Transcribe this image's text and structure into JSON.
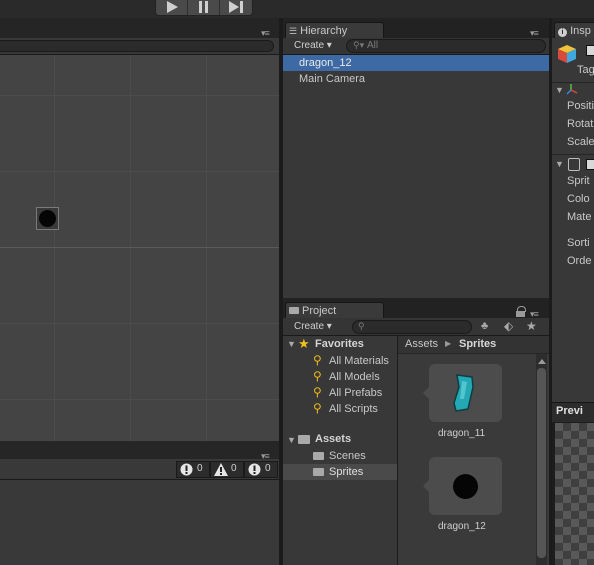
{
  "play_controls": {
    "play_icon": "play-icon",
    "pause_icon": "pause-icon",
    "step_icon": "step-icon"
  },
  "console_counts": {
    "errors": "0",
    "warnings": "0",
    "messages": "0"
  },
  "hierarchy": {
    "tab_label": "Hierarchy",
    "create_label": "Create",
    "search_placeholder": "All",
    "items": [
      {
        "label": "dragon_12",
        "selected": true
      },
      {
        "label": "Main Camera",
        "selected": false
      }
    ]
  },
  "project": {
    "tab_label": "Project",
    "create_label": "Create",
    "favorites_label": "Favorites",
    "favorites": [
      "All Materials",
      "All Models",
      "All Prefabs",
      "All Scripts"
    ],
    "assets_label": "Assets",
    "assets_children": [
      {
        "label": "Scenes",
        "selected": false
      },
      {
        "label": "Sprites",
        "selected": true
      }
    ],
    "breadcrumb": {
      "root": "Assets",
      "current": "Sprites"
    },
    "files": [
      {
        "label": "dragon_11",
        "icon": "teal-shape-sprite-icon"
      },
      {
        "label": "dragon_12",
        "icon": "black-circle-sprite-icon"
      }
    ]
  },
  "inspector": {
    "tab_label": "Insp",
    "tag_label": "Tag",
    "transform_fields": [
      "Positi",
      "Rotat",
      "Scale"
    ],
    "sprite_fields": [
      "Sprit",
      "Colo",
      "Mate"
    ],
    "sorting_fields": [
      "Sorti",
      "Orde"
    ],
    "preview_label": "Previ"
  },
  "colors": {
    "selection": "#3d6aa4",
    "teal": "#24a8b3",
    "background": "#383838"
  }
}
